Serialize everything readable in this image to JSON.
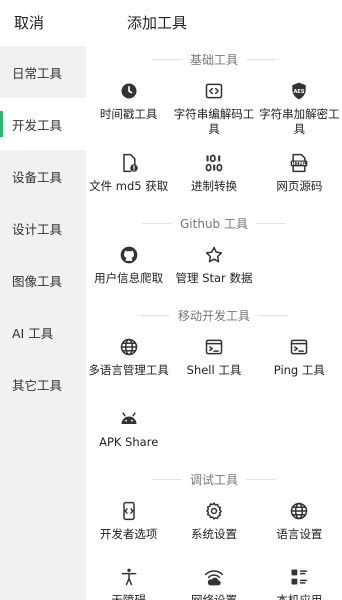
{
  "header": {
    "cancel": "取消",
    "title": "添加工具"
  },
  "sidebar": {
    "items": [
      {
        "label": "日常工具"
      },
      {
        "label": "开发工具"
      },
      {
        "label": "设备工具"
      },
      {
        "label": "设计工具"
      },
      {
        "label": "图像工具"
      },
      {
        "label": "AI 工具"
      },
      {
        "label": "其它工具"
      }
    ],
    "active_index": 1
  },
  "sections": [
    {
      "title": "基础工具",
      "tools": [
        {
          "label": "时间戳工具",
          "icon": "clock-icon"
        },
        {
          "label": "字符串编解码工具",
          "icon": "code-icon"
        },
        {
          "label": "字符串加解密工具",
          "icon": "aes-shield-icon"
        },
        {
          "label": "文件 md5 获取",
          "icon": "file-alert-icon"
        },
        {
          "label": "进制转换",
          "icon": "binary-icon"
        },
        {
          "label": "网页源码",
          "icon": "html-file-icon"
        }
      ]
    },
    {
      "title": "Github 工具",
      "tools": [
        {
          "label": "用户信息爬取",
          "icon": "github-icon"
        },
        {
          "label": "管理 Star 数据",
          "icon": "star-icon"
        }
      ]
    },
    {
      "title": "移动开发工具",
      "tools": [
        {
          "label": "多语言管理工具",
          "icon": "globe-icon"
        },
        {
          "label": "Shell 工具",
          "icon": "terminal-icon"
        },
        {
          "label": "Ping 工具",
          "icon": "terminal-icon"
        },
        {
          "label": "APK Share",
          "icon": "android-icon"
        }
      ]
    },
    {
      "title": "调试工具",
      "tools": [
        {
          "label": "开发者选项",
          "icon": "developer-mode-icon"
        },
        {
          "label": "系统设置",
          "icon": "gear-icon"
        },
        {
          "label": "语言设置",
          "icon": "globe-icon"
        },
        {
          "label": "无障碍",
          "icon": "accessibility-icon"
        },
        {
          "label": "网络设置",
          "icon": "wifi-cloud-icon"
        },
        {
          "label": "本机应用",
          "icon": "app-list-icon"
        }
      ]
    }
  ],
  "colors": {
    "accent": "#2bb673",
    "sidebar_bg": "#f1f1f1",
    "divider": "#e3e3e3"
  }
}
